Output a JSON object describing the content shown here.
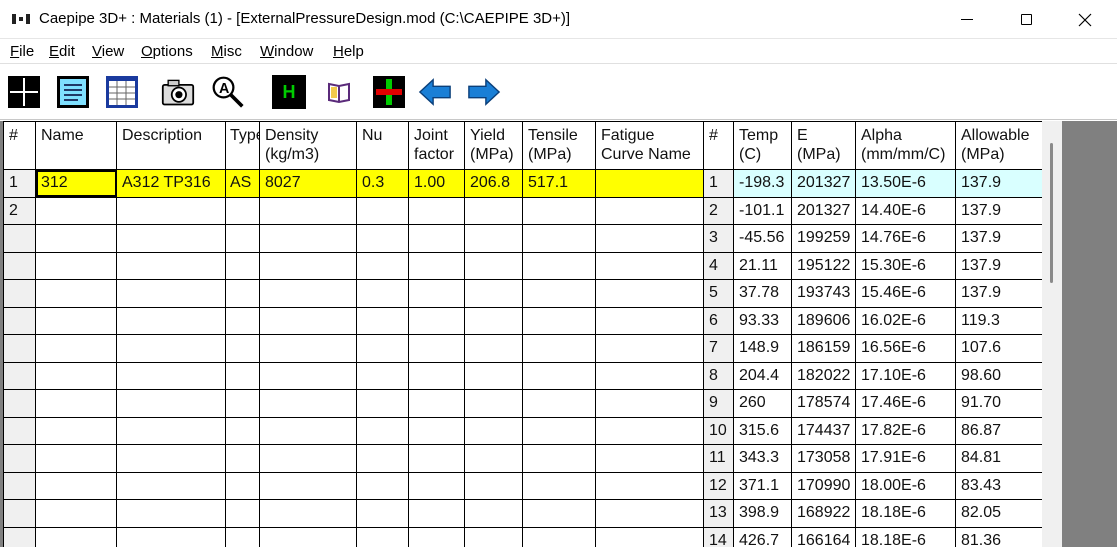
{
  "window": {
    "title": "Caepipe 3D+ : Materials  (1)  -  [ExternalPressureDesign.mod (C:\\CAEPIPE 3D+)]",
    "controls": [
      "minimize-icon",
      "maximize-icon",
      "close-icon"
    ]
  },
  "menu": {
    "items": [
      {
        "label": "File",
        "mnemonic": "F",
        "rest": "ile"
      },
      {
        "label": "Edit",
        "mnemonic": "E",
        "rest": "dit"
      },
      {
        "label": "View",
        "mnemonic": "V",
        "rest": "iew"
      },
      {
        "label": "Options",
        "mnemonic": "O",
        "rest": "ptions"
      },
      {
        "label": "Misc",
        "mnemonic": "M",
        "rest": "isc"
      },
      {
        "label": "Window",
        "mnemonic": "W",
        "rest": "indow"
      },
      {
        "label": "Help",
        "mnemonic": "H",
        "rest": "elp"
      }
    ]
  },
  "toolbar": {
    "buttons": [
      "graphics-window-icon",
      "list-window-icon",
      "table-window-icon",
      "camera-icon",
      "zoom-magnifier-icon",
      "help-h-icon",
      "book-icon",
      "split-window-icon",
      "back-arrow-icon",
      "forward-arrow-icon"
    ],
    "help_letter": "H",
    "colors": {
      "accent_blue": "#1a7fd6",
      "help_green": "#00cc00",
      "split_red": "#e00000"
    }
  },
  "materials_table": {
    "columns": [
      "#",
      "Name",
      "Description",
      "Type",
      "Density (kg/m3)",
      "Nu",
      "Joint factor",
      "Yield (MPa)",
      "Tensile (MPa)",
      "Fatigue Curve Name"
    ],
    "rows": [
      {
        "num": "1",
        "name": "312",
        "description": "A312 TP316",
        "type": "AS",
        "density": "8027",
        "nu": "0.3",
        "joint_factor": "1.00",
        "yield": "206.8",
        "tensile": "517.1",
        "fatigue": ""
      },
      {
        "num": "2",
        "name": "",
        "description": "",
        "type": "",
        "density": "",
        "nu": "",
        "joint_factor": "",
        "yield": "",
        "tensile": "",
        "fatigue": ""
      }
    ],
    "selected_color": "#ffff00"
  },
  "properties_table": {
    "columns": [
      "#",
      "Temp (C)",
      "E (MPa)",
      "Alpha (mm/mm/C)",
      "Allowable (MPa)"
    ],
    "rows": [
      {
        "num": "1",
        "temp": "-198.3",
        "e": "201327",
        "alpha": "13.50E-6",
        "allowable": "137.9"
      },
      {
        "num": "2",
        "temp": "-101.1",
        "e": "201327",
        "alpha": "14.40E-6",
        "allowable": "137.9"
      },
      {
        "num": "3",
        "temp": "-45.56",
        "e": "199259",
        "alpha": "14.76E-6",
        "allowable": "137.9"
      },
      {
        "num": "4",
        "temp": "21.11",
        "e": "195122",
        "alpha": "15.30E-6",
        "allowable": "137.9"
      },
      {
        "num": "5",
        "temp": "37.78",
        "e": "193743",
        "alpha": "15.46E-6",
        "allowable": "137.9"
      },
      {
        "num": "6",
        "temp": "93.33",
        "e": "189606",
        "alpha": "16.02E-6",
        "allowable": "119.3"
      },
      {
        "num": "7",
        "temp": "148.9",
        "e": "186159",
        "alpha": "16.56E-6",
        "allowable": "107.6"
      },
      {
        "num": "8",
        "temp": "204.4",
        "e": "182022",
        "alpha": "17.10E-6",
        "allowable": "98.60"
      },
      {
        "num": "9",
        "temp": "260",
        "e": "178574",
        "alpha": "17.46E-6",
        "allowable": "91.70"
      },
      {
        "num": "10",
        "temp": "315.6",
        "e": "174437",
        "alpha": "17.82E-6",
        "allowable": "86.87"
      },
      {
        "num": "11",
        "temp": "343.3",
        "e": "173058",
        "alpha": "17.91E-6",
        "allowable": "84.81"
      },
      {
        "num": "12",
        "temp": "371.1",
        "e": "170990",
        "alpha": "18.00E-6",
        "allowable": "83.43"
      },
      {
        "num": "13",
        "temp": "398.9",
        "e": "168922",
        "alpha": "18.18E-6",
        "allowable": "82.05"
      },
      {
        "num": "14",
        "temp": "426.7",
        "e": "166164",
        "alpha": "18.18E-6",
        "allowable": "81.36"
      }
    ],
    "highlight_color": "#d9ffff"
  }
}
